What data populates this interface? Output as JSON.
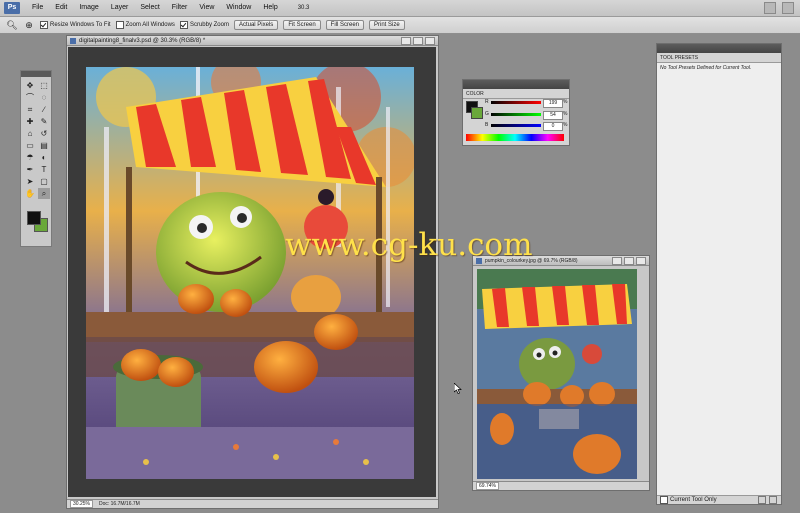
{
  "app": {
    "logo": "Ps"
  },
  "menu": [
    "File",
    "Edit",
    "Image",
    "Layer",
    "Select",
    "Filter",
    "View",
    "Window",
    "Help"
  ],
  "menu_zoom": "30.3",
  "options": {
    "resize_windows": "Resize Windows To Fit",
    "zoom_all": "Zoom All Windows",
    "scrubby_zoom": "Scrubby Zoom",
    "actual_pixels": "Actual Pixels",
    "fit_screen": "Fit Screen",
    "fill_screen": "Fill Screen",
    "print_size": "Print Size"
  },
  "main_doc": {
    "title": "digitalpainting8_finalv3.psd @ 30.3% (RGB/8) *",
    "zoom": "30.25%",
    "doc_size": "Doc: 16.7M/16.7M"
  },
  "second_doc": {
    "title": "pumpkin_colourkey.jpg @ 69.7% (RGB/8)",
    "zoom": "69.74%"
  },
  "color_panel": {
    "title": "COLOR",
    "r_label": "R",
    "g_label": "G",
    "b_label": "B",
    "r": "199",
    "g": "54",
    "b": "0",
    "r_pct": "%",
    "g_pct": "%",
    "b_pct": "%",
    "fg": "#101010",
    "bg": "#6aa83a"
  },
  "tool_presets": {
    "title": "TOOL PRESETS",
    "empty_msg": "No Tool Presets Defined for Current Tool.",
    "current_only": "Current Tool Only"
  },
  "watermark": "www.cg-ku.com"
}
